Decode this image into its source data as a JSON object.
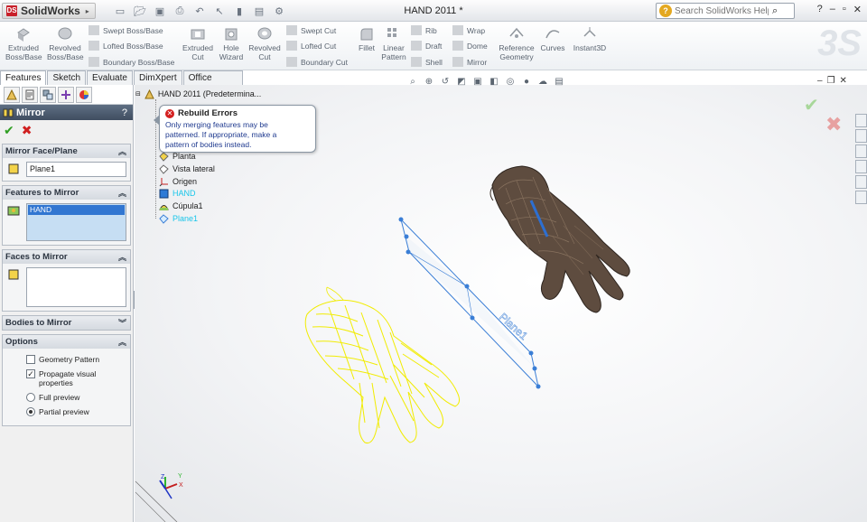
{
  "app": {
    "logo_text": "SolidWorks",
    "document_title": "HAND 2011 *",
    "help_search_placeholder": "Search SolidWorks Help"
  },
  "ribbon": {
    "big_buttons": [
      {
        "label_1": "Extruded",
        "label_2": "Boss/Base"
      },
      {
        "label_1": "Revolved",
        "label_2": "Boss/Base"
      },
      {
        "label_1": "Extruded",
        "label_2": "Cut"
      },
      {
        "label_1": "Hole",
        "label_2": "Wizard"
      },
      {
        "label_1": "Revolved",
        "label_2": "Cut"
      },
      {
        "label_1": "Fillet",
        "label_2": ""
      },
      {
        "label_1": "Linear",
        "label_2": "Pattern"
      },
      {
        "label_1": "Reference",
        "label_2": "Geometry"
      },
      {
        "label_1": "Curves",
        "label_2": ""
      },
      {
        "label_1": "Instant3D",
        "label_2": ""
      }
    ],
    "small_buttons": {
      "swept_boss": "Swept Boss/Base",
      "lofted_boss": "Lofted Boss/Base",
      "boundary_boss": "Boundary Boss/Base",
      "swept_cut": "Swept Cut",
      "lofted_cut": "Lofted Cut",
      "boundary_cut": "Boundary Cut",
      "rib": "Rib",
      "draft": "Draft",
      "shell": "Shell",
      "wrap": "Wrap",
      "dome": "Dome",
      "mirror": "Mirror"
    }
  },
  "tabs": [
    "Features",
    "Sketch",
    "Evaluate",
    "DimXpert",
    "Office Products"
  ],
  "property_manager": {
    "title": "Mirror",
    "help": "?",
    "ok": "✔",
    "cancel": "✖",
    "mirror_face": {
      "header": "Mirror Face/Plane",
      "value": "Plane1"
    },
    "features": {
      "header": "Features to Mirror",
      "item": "HAND"
    },
    "faces": {
      "header": "Faces to Mirror"
    },
    "bodies": {
      "header": "Bodies to Mirror"
    },
    "options": {
      "header": "Options",
      "geometry_pattern": "Geometry Pattern",
      "propagate_1": "Propagate visual",
      "propagate_2": "properties",
      "full_preview": "Full preview",
      "partial_preview": "Partial preview",
      "geometry_pattern_checked": false,
      "propagate_checked": true,
      "preview_mode": "partial"
    }
  },
  "tree": {
    "root": "HAND 2011  (Predetermina...",
    "items": [
      "Planta",
      "Vista lateral",
      "Origen",
      "HAND",
      "Cúpula1",
      "Plane1"
    ]
  },
  "tooltip": {
    "title": "Rebuild Errors",
    "line1": "Only merging features may be",
    "line2": "patterned. If appropriate, make a",
    "line3": "pattern of bodies instead."
  },
  "viewport": {
    "plane_label": "Plane1",
    "axis_x": "X",
    "axis_y": "Y",
    "axis_z": "Z"
  },
  "colors": {
    "selected_text": "#19c6ea",
    "preview_yellow": "#f3ee00",
    "plane_blue": "#3a7ed6",
    "hand_brown": "#5b4a3e",
    "header_blue": "#4a5a6f"
  },
  "icons": {
    "ok": "check-icon",
    "cancel": "cross-icon",
    "error": "error-icon"
  }
}
